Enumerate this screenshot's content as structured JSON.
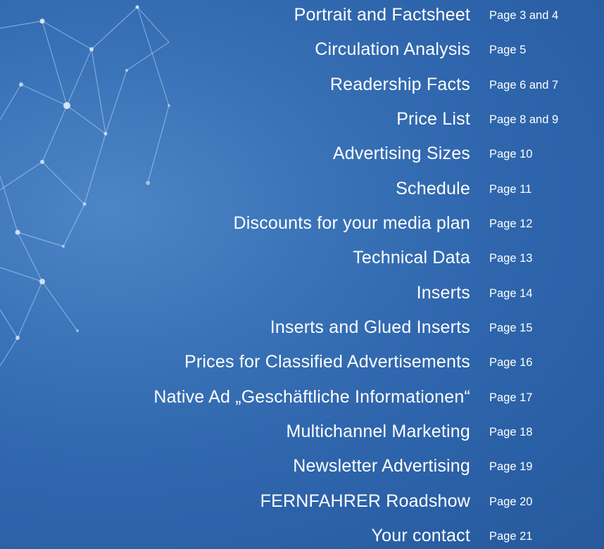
{
  "toc": [
    {
      "title": "Portrait and Factsheet",
      "page": "Page 3 and 4"
    },
    {
      "title": "Circulation Analysis",
      "page": "Page 5"
    },
    {
      "title": "Readership Facts",
      "page": "Page 6 and 7"
    },
    {
      "title": "Price List",
      "page": "Page 8 and 9"
    },
    {
      "title": "Advertising Sizes",
      "page": "Page 10"
    },
    {
      "title": "Schedule",
      "page": "Page 11"
    },
    {
      "title": "Discounts for your media plan",
      "page": "Page 12"
    },
    {
      "title": "Technical Data",
      "page": "Page 13"
    },
    {
      "title": "Inserts",
      "page": "Page 14"
    },
    {
      "title": "Inserts and Glued Inserts",
      "page": "Page 15"
    },
    {
      "title": "Prices for Classified Advertisements",
      "page": "Page 16"
    },
    {
      "title": "Native Ad „Geschäftliche Informationen“",
      "page": "Page 17"
    },
    {
      "title": "Multichannel Marketing",
      "page": "Page 18"
    },
    {
      "title": "Newsletter Advertising",
      "page": "Page 19"
    },
    {
      "title": "FERNFAHRER Roadshow",
      "page": "Page 20"
    },
    {
      "title": "Your contact",
      "page": "Page 21"
    }
  ],
  "colors": {
    "background": "#2f66ad",
    "text": "#ffffff",
    "network": "#d6e8ff"
  }
}
